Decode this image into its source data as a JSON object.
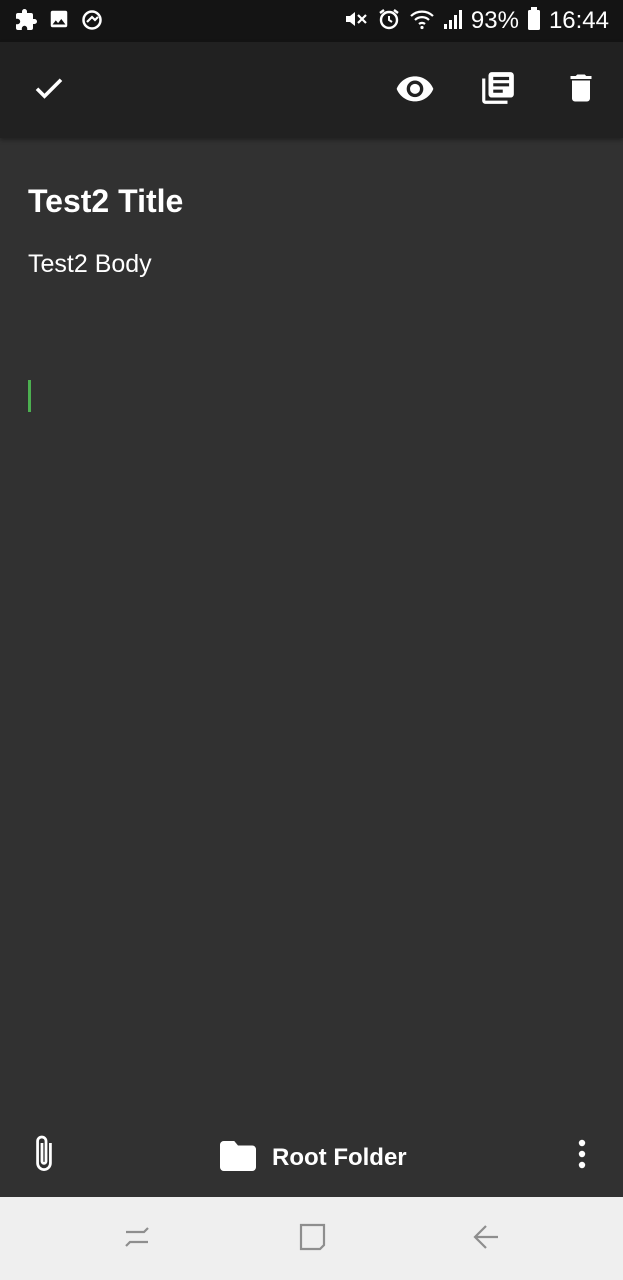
{
  "status_bar": {
    "left_icons": [
      "puzzle-icon",
      "image-icon",
      "sync-icon"
    ],
    "right_icons": [
      "mute-icon",
      "alarm-icon",
      "wifi-icon",
      "signal-icon",
      "battery-icon"
    ],
    "battery": "93%",
    "time": "16:44"
  },
  "toolbar": {
    "icons": [
      "check-icon",
      "eye-icon",
      "notes-icon",
      "trash-icon"
    ]
  },
  "note": {
    "title": "Test2 Title",
    "body": "Test2 Body",
    "cursor_color": "#4caf50"
  },
  "bottom_bar": {
    "folder_label": "Root Folder",
    "icons": [
      "paperclip-icon",
      "folder-icon",
      "more-vert-icon"
    ]
  },
  "nav_bar": {
    "icons": [
      "recents-icon",
      "home-icon",
      "back-icon"
    ]
  },
  "colors": {
    "status_bar": "#141414",
    "toolbar": "#212121",
    "background": "#313131",
    "nav_bar": "#efefef",
    "accent": "#4caf50"
  }
}
